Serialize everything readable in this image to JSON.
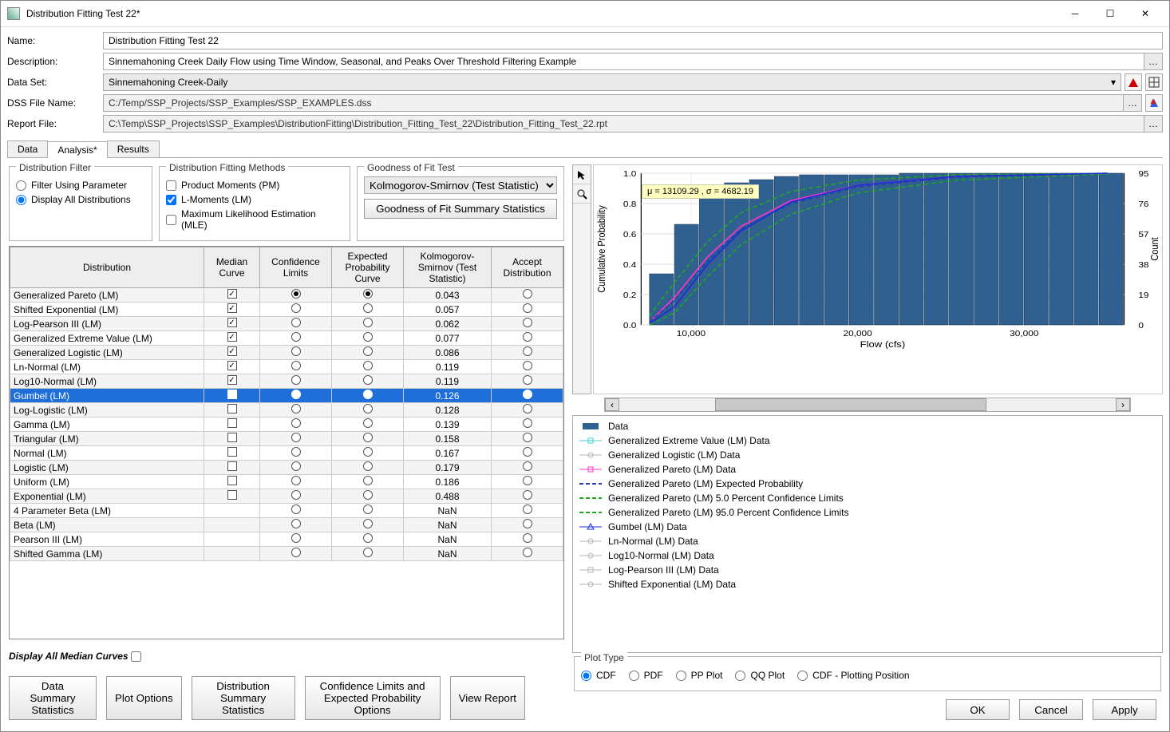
{
  "window": {
    "title": "Distribution Fitting Test 22*"
  },
  "form": {
    "name_label": "Name:",
    "name_value": "Distribution Fitting Test 22",
    "desc_label": "Description:",
    "desc_value": "Sinnemahoning Creek Daily Flow using Time Window, Seasonal, and Peaks Over Threshold Filtering Example",
    "dataset_label": "Data Set:",
    "dataset_value": "Sinnemahoning Creek-Daily",
    "dssfile_label": "DSS File Name:",
    "dssfile_value": "C:/Temp/SSP_Projects/SSP_Examples/SSP_EXAMPLES.dss",
    "report_label": "Report File:",
    "report_value": "C:\\Temp\\SSP_Projects\\SSP_Examples\\DistributionFitting\\Distribution_Fitting_Test_22\\Distribution_Fitting_Test_22.rpt"
  },
  "tabs": {
    "data": "Data",
    "analysis": "Analysis*",
    "results": "Results"
  },
  "groups": {
    "filter_legend": "Distribution Filter",
    "filter_param": "Filter Using Parameter",
    "filter_all": "Display All Distributions",
    "methods_legend": "Distribution Fitting Methods",
    "pm": "Product Moments (PM)",
    "lm": "L-Moments (LM)",
    "mle": "Maximum Likelihood Estimation (MLE)",
    "gof_legend": "Goodness of Fit Test",
    "gof_select": "Kolmogorov-Smirnov (Test Statistic)",
    "gof_btn": "Goodness of Fit Summary Statistics"
  },
  "table": {
    "headers": {
      "dist": "Distribution",
      "median": "Median Curve",
      "conf": "Confidence Limits",
      "expected": "Expected Probability Curve",
      "ks": "Kolmogorov-Smirnov (Test Statistic)",
      "accept": "Accept Distribution"
    },
    "rows": [
      {
        "name": "Generalized Pareto (LM)",
        "median": true,
        "conf": true,
        "exp": true,
        "ks": "0.043",
        "accept": false
      },
      {
        "name": "Shifted Exponential (LM)",
        "median": true,
        "conf": false,
        "exp": false,
        "ks": "0.057",
        "accept": false
      },
      {
        "name": "Log-Pearson III (LM)",
        "median": true,
        "conf": false,
        "exp": false,
        "ks": "0.062",
        "accept": false
      },
      {
        "name": "Generalized Extreme Value (LM)",
        "median": true,
        "conf": false,
        "exp": false,
        "ks": "0.077",
        "accept": false
      },
      {
        "name": "Generalized Logistic (LM)",
        "median": true,
        "conf": false,
        "exp": false,
        "ks": "0.086",
        "accept": false
      },
      {
        "name": "Ln-Normal (LM)",
        "median": true,
        "conf": false,
        "exp": false,
        "ks": "0.119",
        "accept": false
      },
      {
        "name": "Log10-Normal (LM)",
        "median": true,
        "conf": false,
        "exp": false,
        "ks": "0.119",
        "accept": false
      },
      {
        "name": "Gumbel (LM)",
        "median": true,
        "conf": false,
        "exp": false,
        "ks": "0.126",
        "accept": false,
        "selected": true
      },
      {
        "name": "Log-Logistic (LM)",
        "median": false,
        "conf": false,
        "exp": false,
        "ks": "0.128",
        "accept": false
      },
      {
        "name": "Gamma (LM)",
        "median": false,
        "conf": false,
        "exp": false,
        "ks": "0.139",
        "accept": false
      },
      {
        "name": "Triangular (LM)",
        "median": false,
        "conf": false,
        "exp": false,
        "ks": "0.158",
        "accept": false
      },
      {
        "name": "Normal (LM)",
        "median": false,
        "conf": false,
        "exp": false,
        "ks": "0.167",
        "accept": false
      },
      {
        "name": "Logistic (LM)",
        "median": false,
        "conf": false,
        "exp": false,
        "ks": "0.179",
        "accept": false
      },
      {
        "name": "Uniform (LM)",
        "median": false,
        "conf": false,
        "exp": false,
        "ks": "0.186",
        "accept": false
      },
      {
        "name": "Exponential (LM)",
        "median": false,
        "conf": false,
        "exp": false,
        "ks": "0.488",
        "accept": false
      },
      {
        "name": "4 Parameter Beta (LM)",
        "median": null,
        "conf": false,
        "exp": false,
        "ks": "NaN",
        "accept": false
      },
      {
        "name": "Beta (LM)",
        "median": null,
        "conf": false,
        "exp": false,
        "ks": "NaN",
        "accept": false
      },
      {
        "name": "Pearson III (LM)",
        "median": null,
        "conf": false,
        "exp": false,
        "ks": "NaN",
        "accept": false
      },
      {
        "name": "Shifted Gamma (LM)",
        "median": null,
        "conf": false,
        "exp": false,
        "ks": "NaN",
        "accept": false
      }
    ]
  },
  "below": {
    "display_all_median": "Display All Median Curves"
  },
  "botbtns": {
    "summary": "Data Summary Statistics",
    "plotopt": "Plot Options",
    "distsum": "Distribution Summary Statistics",
    "conf": "Confidence Limits and Expected Probability Options",
    "view": "View Report"
  },
  "chart_data": {
    "type": "line",
    "xlabel": "Flow (cfs)",
    "ylabel": "Cumulative Probability",
    "y2label": "Count",
    "xlim": [
      7000,
      36000
    ],
    "ylim": [
      0.0,
      1.0
    ],
    "y2lim": [
      0,
      95
    ],
    "xticks": [
      10000,
      20000,
      30000
    ],
    "xtick_labels": [
      "10,000",
      "20,000",
      "30,000"
    ],
    "yticks": [
      0.0,
      0.2,
      0.4,
      0.6,
      0.8,
      1.0
    ],
    "y2ticks": [
      0,
      19,
      38,
      57,
      76,
      95
    ],
    "annotation": "μ = 13109.29 , σ = 4682.19",
    "histogram": {
      "bin_edges": [
        7500,
        9000,
        10500,
        12000,
        13500,
        15000,
        16500,
        18000,
        19500,
        21000,
        22500,
        24000,
        25500,
        27000,
        28500,
        30000,
        31500,
        33000,
        34500,
        36000
      ],
      "counts": [
        32,
        63,
        85,
        89,
        91,
        93,
        94,
        94,
        94,
        94,
        95,
        95,
        95,
        95,
        95,
        95,
        95,
        95,
        95
      ]
    },
    "series": [
      {
        "name": "Generalized Pareto (LM) Data",
        "color": "#ff33cc",
        "x": [
          7500,
          9000,
          11000,
          13000,
          16000,
          20000,
          26000,
          35000
        ],
        "y": [
          0.02,
          0.18,
          0.45,
          0.65,
          0.82,
          0.92,
          0.98,
          1.0
        ]
      },
      {
        "name": "Generalized Pareto (LM) Expected Probability",
        "color": "#1e40af",
        "dash": true,
        "x": [
          7500,
          9000,
          11000,
          13000,
          16000,
          20000,
          26000,
          35000
        ],
        "y": [
          0.02,
          0.16,
          0.42,
          0.63,
          0.8,
          0.91,
          0.975,
          1.0
        ]
      },
      {
        "name": "Generalized Pareto (LM) 5.0 Percent Confidence Limits",
        "color": "#1fa81f",
        "dash": true,
        "x": [
          7500,
          9000,
          11000,
          13000,
          16000,
          20000,
          26000,
          35000
        ],
        "y": [
          0.06,
          0.28,
          0.55,
          0.74,
          0.88,
          0.955,
          0.99,
          1.0
        ]
      },
      {
        "name": "Generalized Pareto (LM) 95.0 Percent Confidence Limits",
        "color": "#1fa81f",
        "dash": true,
        "x": [
          7500,
          9000,
          11000,
          13000,
          16000,
          20000,
          26000,
          35000
        ],
        "y": [
          0.0,
          0.08,
          0.32,
          0.53,
          0.73,
          0.87,
          0.955,
          0.995
        ]
      },
      {
        "name": "Gumbel (LM) Data",
        "color": "#1d2bd8",
        "x": [
          7500,
          9000,
          11000,
          13000,
          16000,
          20000,
          26000,
          35000
        ],
        "y": [
          0.01,
          0.12,
          0.4,
          0.62,
          0.81,
          0.92,
          0.98,
          1.0
        ]
      }
    ]
  },
  "legend": [
    {
      "label": "Data",
      "color": "#2f608f",
      "type": "bar"
    },
    {
      "label": "Generalized Extreme Value (LM) Data",
      "color": "#3ad1d1",
      "type": "linebox"
    },
    {
      "label": "Generalized Logistic (LM) Data",
      "color": "#b5b5b5",
      "type": "linecirc"
    },
    {
      "label": "Generalized Pareto (LM) Data",
      "color": "#ff33cc",
      "type": "linebox"
    },
    {
      "label": "Generalized Pareto (LM) Expected Probability",
      "color": "#1e40af",
      "type": "dash"
    },
    {
      "label": "Generalized Pareto (LM) 5.0 Percent Confidence Limits",
      "color": "#1fa81f",
      "type": "dash"
    },
    {
      "label": "Generalized Pareto (LM) 95.0 Percent Confidence Limits",
      "color": "#1fa81f",
      "type": "dash"
    },
    {
      "label": "Gumbel (LM) Data",
      "color": "#1d2bd8",
      "type": "linetri"
    },
    {
      "label": "Ln-Normal (LM) Data",
      "color": "#b5b5b5",
      "type": "linecirc"
    },
    {
      "label": "Log10-Normal (LM) Data",
      "color": "#b5b5b5",
      "type": "linecirc"
    },
    {
      "label": "Log-Pearson III (LM) Data",
      "color": "#b5b5b5",
      "type": "linebox"
    },
    {
      "label": "Shifted Exponential (LM) Data",
      "color": "#b5b5b5",
      "type": "linecirc"
    }
  ],
  "plottype": {
    "legend": "Plot Type",
    "cdf": "CDF",
    "pdf": "PDF",
    "pp": "PP Plot",
    "qq": "QQ Plot",
    "cdfpp": "CDF - Plotting Position"
  },
  "dlgbtns": {
    "ok": "OK",
    "cancel": "Cancel",
    "apply": "Apply"
  }
}
